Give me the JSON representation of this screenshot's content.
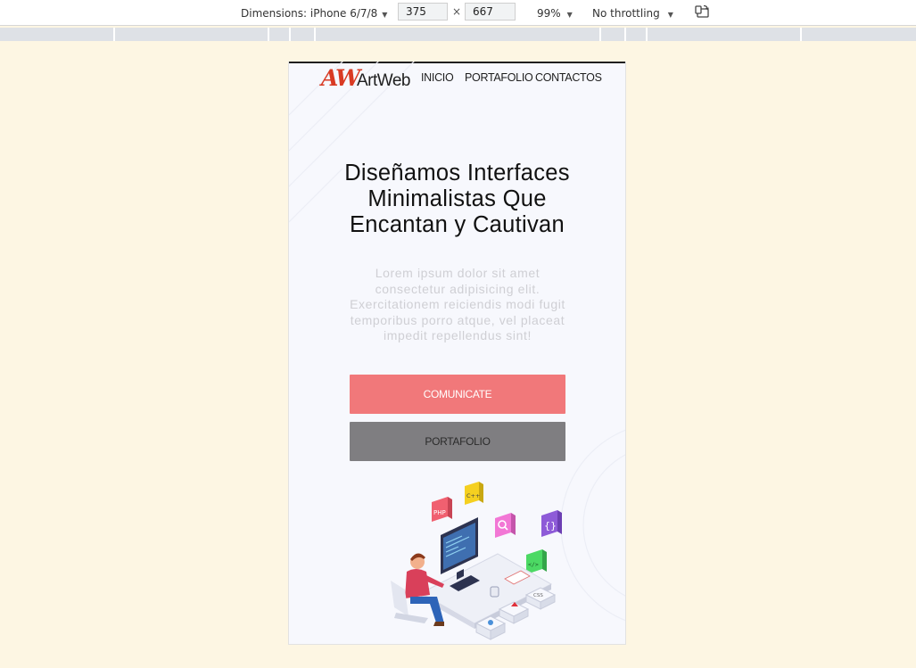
{
  "devtools": {
    "dimensions_label": "Dimensions: iPhone 6/7/8",
    "width_value": "375",
    "height_value": "667",
    "times_symbol": "×",
    "zoom": "99%",
    "throttling": "No throttling",
    "caret": "▼",
    "rotate_icon": "rotate-device-icon"
  },
  "site": {
    "logo_mark": "AW",
    "logo_text": "ArtWeb",
    "nav": [
      "INICIO",
      "PORTAFOLIO",
      "CONTACTOS"
    ],
    "hero": {
      "title_lines": [
        "Diseñamos Interfaces",
        "Minimalistas Que",
        "Encantan y Cautivan"
      ],
      "text_lines": [
        "Lorem ipsum dolor sit amet",
        "consectetur adipisicing elit.",
        "Exercitationem reiciendis modi fugit",
        "temporibus porro atque, vel placeat",
        "impedit repellendus sint!"
      ]
    },
    "buttons": {
      "primary": "COMUNICATE",
      "secondary": "PORTAFOLIO"
    },
    "illustration": {
      "icon_labels": {
        "php": "PHP",
        "cpp": "C++",
        "css": "CSS"
      },
      "colors": {
        "php": "#f06070",
        "cpp": "#f5d020",
        "search": "#f277d5",
        "braces": "#8e5bd8",
        "code": "#4cd964",
        "shirt": "#d9405a"
      }
    }
  },
  "colors": {
    "primary_button": "#f1787a",
    "secondary_button": "#7f7e81",
    "page_background": "#fdf6e3",
    "viewport_background": "#f7f8fd",
    "logo_red": "#d93a23"
  }
}
